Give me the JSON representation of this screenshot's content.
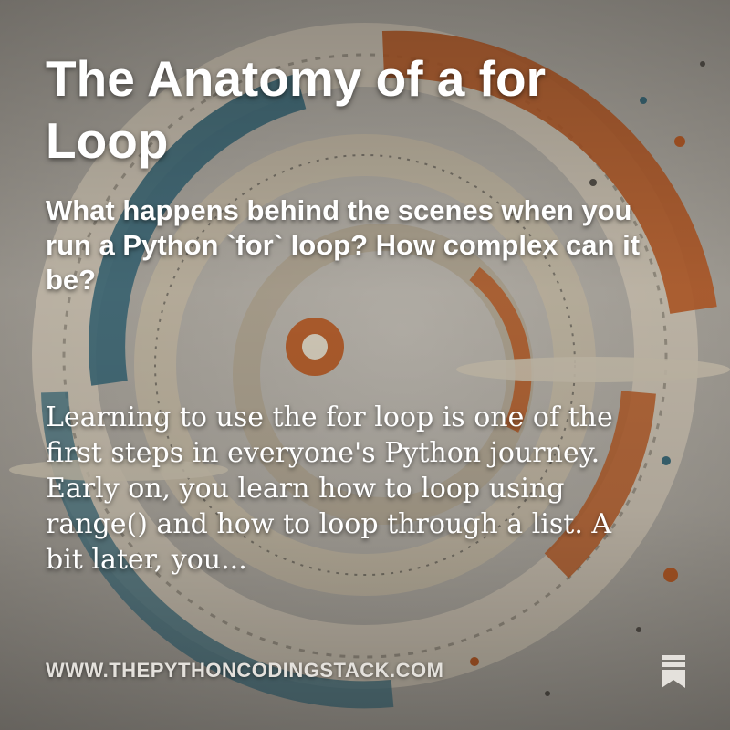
{
  "card": {
    "title": "The Anatomy of a for Loop",
    "subtitle": "What happens behind the scenes when you run a Python `for` loop? How complex can it be?",
    "excerpt": "Learning to use the for loop is one of the first steps in everyone's Python journey. Early on, you learn how to loop using range() and how to loop through a list. A bit later, you...",
    "site_url": "WWW.THEPYTHONCODINGSTACK.COM",
    "bookmark_icon": "bookmark-icon"
  },
  "colors": {
    "text": "#ffffff",
    "url_text": "#e4e1dc",
    "orange": "#c0612a",
    "teal": "#3f6f7e",
    "cream": "#e8dfcc"
  }
}
